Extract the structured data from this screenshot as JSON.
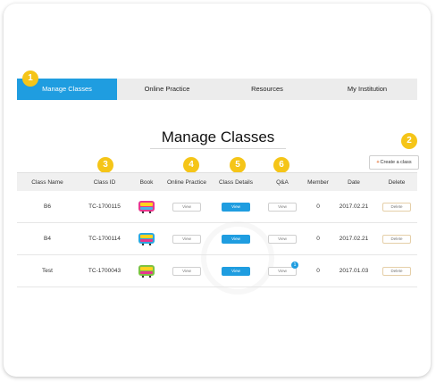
{
  "nav": {
    "items": [
      "Manage Classes",
      "Online Practice",
      "Resources",
      "My Institution"
    ],
    "active": "Manage Classes"
  },
  "page_title": "Manage Classes",
  "create_button": {
    "label": "Create a class"
  },
  "badges": [
    "1",
    "2",
    "3",
    "4",
    "5",
    "6"
  ],
  "table": {
    "headers": [
      "Class Name",
      "Class ID",
      "Book",
      "Online Practice",
      "Class Details",
      "Q&A",
      "Member",
      "Date",
      "Delete"
    ],
    "rows": [
      {
        "name": "B6",
        "id": "TC-1700115",
        "online_practice": "View",
        "class_details": "View",
        "qa": "View",
        "member": "0",
        "date": "2017.02.21",
        "delete": "Delete"
      },
      {
        "name": "B4",
        "id": "TC-1700114",
        "online_practice": "View",
        "class_details": "View",
        "qa": "View",
        "member": "0",
        "date": "2017.02.21",
        "delete": "Delete"
      },
      {
        "name": "Test",
        "id": "TC-1700043",
        "online_practice": "View",
        "class_details": "View",
        "qa": "View",
        "qa_notification": "1",
        "member": "0",
        "date": "2017.01.03",
        "delete": "Delete"
      }
    ]
  },
  "book_logo": {
    "text": "ENGLISH BUS"
  },
  "colors": {
    "accent": "#1f9de0",
    "badge": "#f5c518",
    "nav_bg": "#ececec"
  }
}
